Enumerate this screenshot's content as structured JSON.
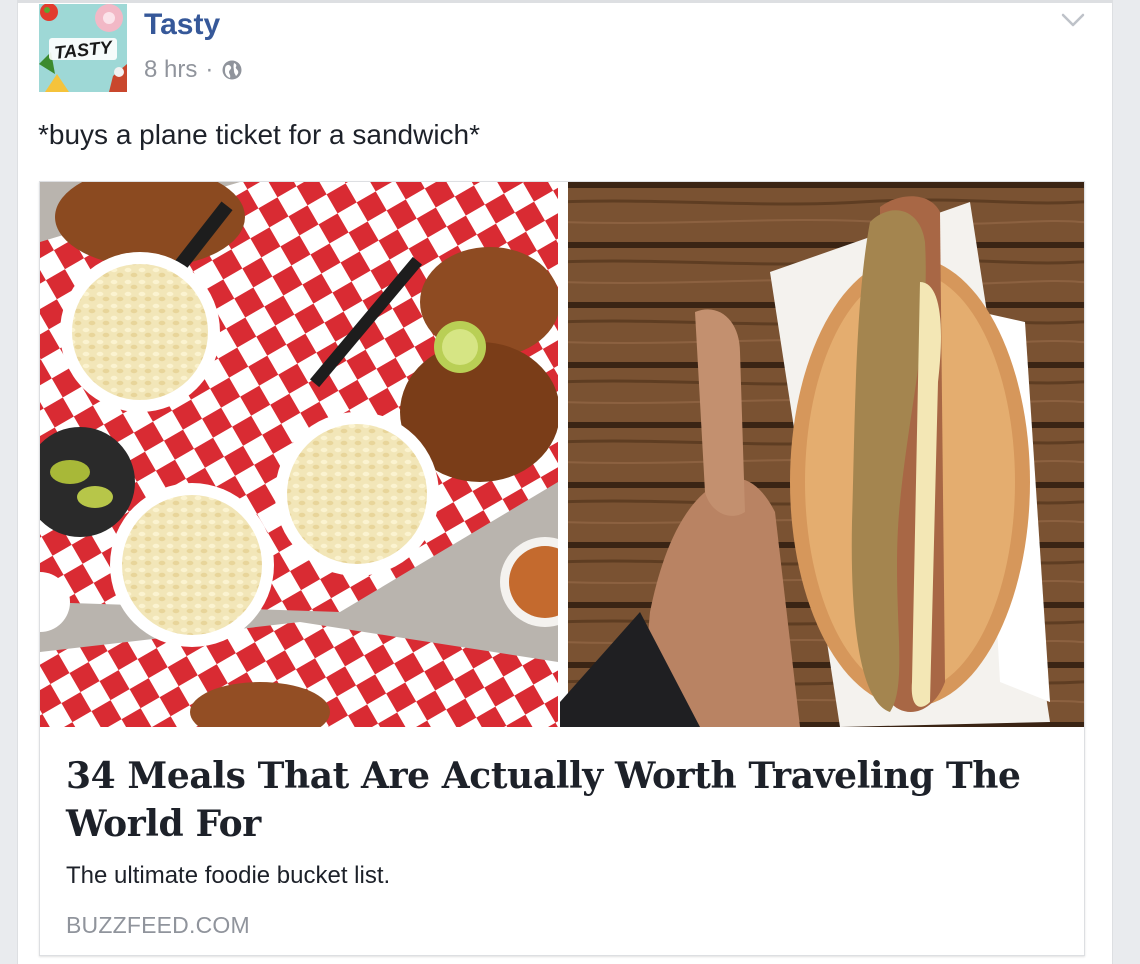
{
  "post": {
    "author": "Tasty",
    "avatar_text": "TASTY",
    "time": "8 hrs",
    "separator": "·",
    "message": "*buys a plane ticket for a sandwich*"
  },
  "link": {
    "title": "34 Meals That Are Actually Worth Traveling The World For",
    "description": "The ultimate foodie bucket list.",
    "domain": "BUZZFEED.COM"
  },
  "colors": {
    "author_link": "#365899",
    "meta_text": "#90949c",
    "body_text": "#1d2129",
    "card_border": "#dddfe2",
    "page_background": "#e9ebee"
  },
  "icons": {
    "privacy": "globe-icon",
    "post_options": "chevron-down-icon"
  }
}
